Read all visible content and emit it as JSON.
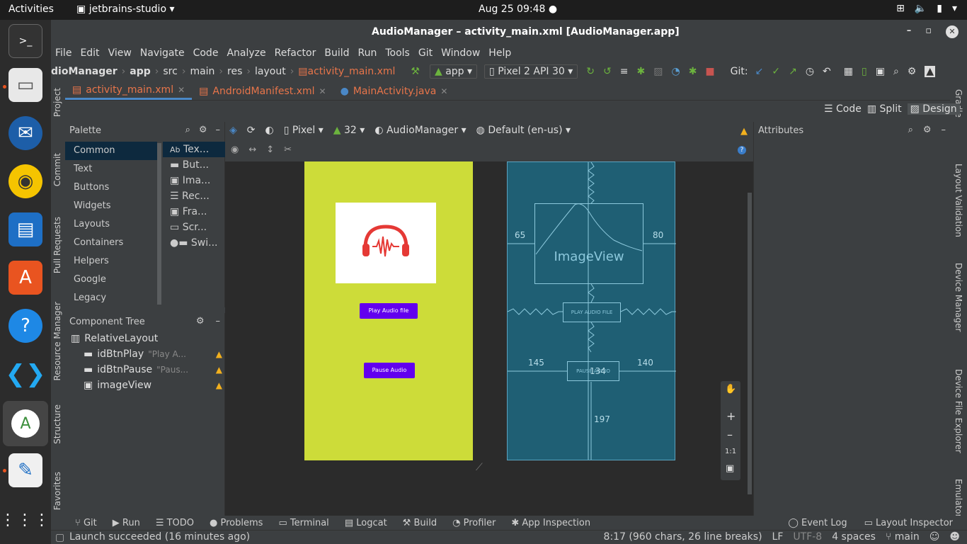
{
  "topbar": {
    "activities": "Activities",
    "app_name": "jetbrains-studio",
    "clock": "Aug 25  09:48"
  },
  "window": {
    "title": "AudioManager – activity_main.xml [AudioManager.app]"
  },
  "menu": [
    "File",
    "Edit",
    "View",
    "Navigate",
    "Code",
    "Analyze",
    "Refactor",
    "Build",
    "Run",
    "Tools",
    "Git",
    "Window",
    "Help"
  ],
  "breadcrumb": [
    "dioManager",
    "app",
    "src",
    "main",
    "res",
    "layout",
    "activity_main.xml"
  ],
  "toolbar": {
    "module": "app",
    "device": "Pixel 2 API 30",
    "git_label": "Git:"
  },
  "tabs": [
    {
      "label": "activity_main.xml"
    },
    {
      "label": "AndroidManifest.xml"
    },
    {
      "label": "MainActivity.java"
    }
  ],
  "left_strip": [
    "Project",
    "Commit",
    "Pull Requests",
    "Resource Manager",
    "Structure",
    "Favorites"
  ],
  "right_strip": [
    "Gradle",
    "Layout Validation",
    "Device Manager",
    "Device File Explorer",
    "Emulator"
  ],
  "view_modes": {
    "code": "Code",
    "split": "Split",
    "design": "Design"
  },
  "palette": {
    "title": "Palette",
    "categories": [
      "Common",
      "Text",
      "Buttons",
      "Widgets",
      "Layouts",
      "Containers",
      "Helpers",
      "Google",
      "Legacy"
    ],
    "items": [
      "Tex...",
      "But...",
      "Ima...",
      "Rec...",
      "Fra...",
      "Scr...",
      "Swi..."
    ]
  },
  "component_tree": {
    "title": "Component Tree",
    "root": "RelativeLayout",
    "children": [
      {
        "name": "idBtnPlay",
        "hint": "\"Play A..."
      },
      {
        "name": "idBtnPause",
        "hint": "\"Paus..."
      },
      {
        "name": "imageView",
        "hint": ""
      }
    ]
  },
  "design_toolbar": {
    "device": "Pixel",
    "api": "32",
    "theme": "AudioManager",
    "locale": "Default (en-us)"
  },
  "preview": {
    "play_button": "Play Audio file",
    "pause_button": "Pause Audio"
  },
  "blueprint": {
    "imageview_label": "ImageView",
    "play_label": "PLAY AUDIO FILE",
    "pause_label": "PAUSE AUDIO",
    "margins": {
      "img_left": "65",
      "img_right": "80",
      "pause_left": "145",
      "pause_right": "140",
      "pause_top": "134",
      "pause_bottom": "197"
    }
  },
  "zoom": {
    "ratio": "1:1"
  },
  "attributes": {
    "title": "Attributes"
  },
  "bottom_tools": [
    "Git",
    "Run",
    "TODO",
    "Problems",
    "Terminal",
    "Logcat",
    "Build",
    "Profiler",
    "App Inspection"
  ],
  "bottom_right": [
    "Event Log",
    "Layout Inspector"
  ],
  "status": {
    "message": "Launch succeeded (16 minutes ago)",
    "position": "8:17 (960 chars, 26 line breaks)",
    "line_sep": "LF",
    "encoding": "UTF-8",
    "indent": "4 spaces",
    "branch": "main"
  }
}
